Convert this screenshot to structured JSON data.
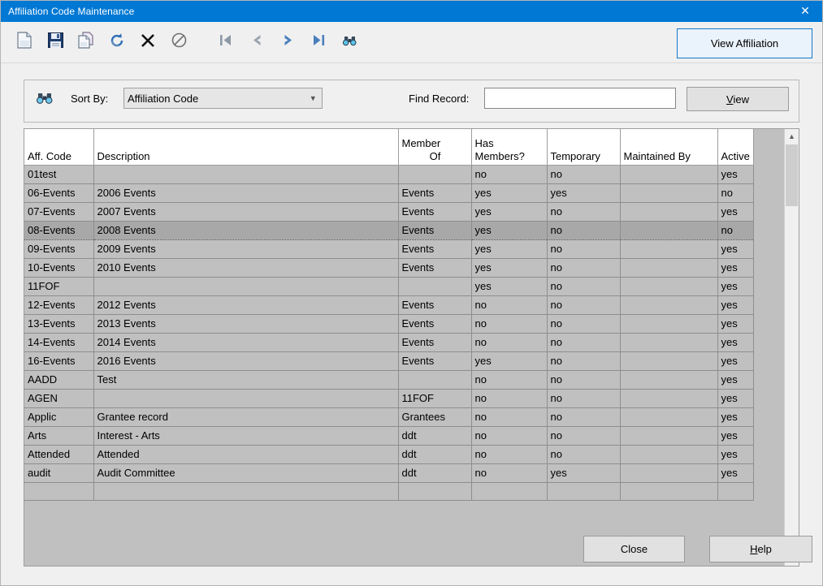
{
  "window": {
    "title": "Affiliation Code Maintenance",
    "close_icon": "close-icon",
    "close_glyph": "✕"
  },
  "toolbar": {
    "items": [
      {
        "name": "new-record-icon",
        "tooltip": "New"
      },
      {
        "name": "save-icon",
        "tooltip": "Save"
      },
      {
        "name": "copy-icon",
        "tooltip": "Copy"
      },
      {
        "name": "refresh-icon",
        "tooltip": "Refresh"
      },
      {
        "name": "delete-icon",
        "tooltip": "Delete"
      },
      {
        "name": "cancel-icon",
        "tooltip": "Cancel"
      },
      {
        "name": "first-record-icon",
        "tooltip": "First"
      },
      {
        "name": "previous-record-icon",
        "tooltip": "Previous"
      },
      {
        "name": "next-record-icon",
        "tooltip": "Next"
      },
      {
        "name": "last-record-icon",
        "tooltip": "Last"
      },
      {
        "name": "find-binoculars-icon",
        "tooltip": "Find"
      }
    ],
    "view_affiliation_label": "View Affiliation",
    "view_affiliation_border_color": "#1278c8",
    "view_affiliation_bg_color": "#eaf3fb"
  },
  "filter_bar": {
    "binoculars_icon": "binoculars-icon",
    "sort_by_label": "Sort By:",
    "sort_by_value": "Affiliation Code",
    "sort_by_options": [
      "Affiliation Code"
    ],
    "find_record_label": "Find Record:",
    "find_record_value": "",
    "find_record_placeholder": "",
    "view_button_accel": "V",
    "view_button_rest": "iew"
  },
  "grid": {
    "columns": [
      {
        "key": "aff_code",
        "label": "Aff. Code",
        "line1": "Aff. Code",
        "line2": ""
      },
      {
        "key": "description",
        "label": "Description",
        "line1": "Description",
        "line2": ""
      },
      {
        "key": "member_of",
        "label": "Member Of",
        "line1": "Member",
        "line2": "Of"
      },
      {
        "key": "has_members",
        "label": "Has Members?",
        "line1": "Has",
        "line2": "Members?"
      },
      {
        "key": "temporary",
        "label": "Temporary",
        "line1": "Temporary",
        "line2": ""
      },
      {
        "key": "maintained_by",
        "label": "Maintained By",
        "line1": "Maintained By",
        "line2": ""
      },
      {
        "key": "active",
        "label": "Active",
        "line1": "Active",
        "line2": ""
      }
    ],
    "rows": [
      {
        "aff_code": "01test",
        "description": "",
        "member_of": "",
        "has_members": "no",
        "temporary": "no",
        "maintained_by": "",
        "active": "yes",
        "selected": false
      },
      {
        "aff_code": "06-Events",
        "description": "2006 Events",
        "member_of": "Events",
        "has_members": "yes",
        "temporary": "yes",
        "maintained_by": "",
        "active": "no",
        "selected": false
      },
      {
        "aff_code": "07-Events",
        "description": "2007 Events",
        "member_of": "Events",
        "has_members": "yes",
        "temporary": "no",
        "maintained_by": "",
        "active": "yes",
        "selected": false
      },
      {
        "aff_code": "08-Events",
        "description": "2008 Events",
        "member_of": "Events",
        "has_members": "yes",
        "temporary": "no",
        "maintained_by": "",
        "active": "no",
        "selected": true
      },
      {
        "aff_code": "09-Events",
        "description": "2009 Events",
        "member_of": "Events",
        "has_members": "yes",
        "temporary": "no",
        "maintained_by": "",
        "active": "yes",
        "selected": false
      },
      {
        "aff_code": "10-Events",
        "description": "2010 Events",
        "member_of": "Events",
        "has_members": "yes",
        "temporary": "no",
        "maintained_by": "",
        "active": "yes",
        "selected": false
      },
      {
        "aff_code": "11FOF",
        "description": "",
        "member_of": "",
        "has_members": "yes",
        "temporary": "no",
        "maintained_by": "",
        "active": "yes",
        "selected": false
      },
      {
        "aff_code": "12-Events",
        "description": "2012 Events",
        "member_of": "Events",
        "has_members": "no",
        "temporary": "no",
        "maintained_by": "",
        "active": "yes",
        "selected": false
      },
      {
        "aff_code": "13-Events",
        "description": "2013 Events",
        "member_of": "Events",
        "has_members": "no",
        "temporary": "no",
        "maintained_by": "",
        "active": "yes",
        "selected": false
      },
      {
        "aff_code": "14-Events",
        "description": "2014 Events",
        "member_of": "Events",
        "has_members": "no",
        "temporary": "no",
        "maintained_by": "",
        "active": "yes",
        "selected": false
      },
      {
        "aff_code": "16-Events",
        "description": "2016 Events",
        "member_of": "Events",
        "has_members": "yes",
        "temporary": "no",
        "maintained_by": "",
        "active": "yes",
        "selected": false
      },
      {
        "aff_code": "AADD",
        "description": "Test",
        "member_of": "",
        "has_members": "no",
        "temporary": "no",
        "maintained_by": "",
        "active": "yes",
        "selected": false
      },
      {
        "aff_code": "AGEN",
        "description": "",
        "member_of": "11FOF",
        "has_members": "no",
        "temporary": "no",
        "maintained_by": "",
        "active": "yes",
        "selected": false
      },
      {
        "aff_code": "Applic",
        "description": "Grantee record",
        "member_of": "Grantees",
        "has_members": "no",
        "temporary": "no",
        "maintained_by": "",
        "active": "yes",
        "selected": false
      },
      {
        "aff_code": "Arts",
        "description": "Interest - Arts",
        "member_of": "ddt",
        "has_members": "no",
        "temporary": "no",
        "maintained_by": "",
        "active": "yes",
        "selected": false
      },
      {
        "aff_code": "Attended",
        "description": "Attended",
        "member_of": "ddt",
        "has_members": "no",
        "temporary": "no",
        "maintained_by": "",
        "active": "yes",
        "selected": false
      },
      {
        "aff_code": "audit",
        "description": "Audit Committee",
        "member_of": "ddt",
        "has_members": "no",
        "temporary": "yes",
        "maintained_by": "",
        "active": "yes",
        "selected": false
      },
      {
        "aff_code": "",
        "description": "",
        "member_of": "",
        "has_members": "",
        "temporary": "",
        "maintained_by": "",
        "active": "",
        "selected": false
      }
    ],
    "scrollbar": {
      "up_arrow_icon": "chevron-up-icon",
      "down_arrow_icon": "chevron-down-icon",
      "up_glyph": "▲",
      "down_glyph": "▼"
    }
  },
  "footer": {
    "close_label": "Close",
    "help_accel": "H",
    "help_rest": "elp"
  }
}
